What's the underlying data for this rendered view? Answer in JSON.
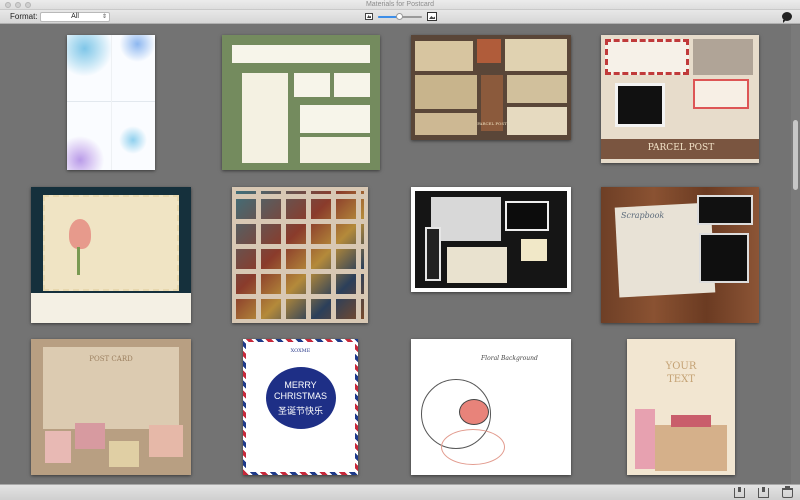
{
  "window": {
    "title": "Materials for Postcard"
  },
  "toolbar": {
    "format_label": "Format:",
    "format_value": "All",
    "zoom_level": 0.5
  },
  "icons": {
    "close": "close-window-icon",
    "minimize": "minimize-window-icon",
    "zoom": "zoom-window-icon",
    "zoom_small": "small-thumbnail-icon",
    "zoom_large": "large-thumbnail-icon",
    "chat": "speech-bubble-icon",
    "import": "import-icon",
    "export": "export-icon",
    "trash": "trash-icon"
  },
  "colors": {
    "background": "#737373",
    "accent": "#3d8ee8"
  },
  "thumbnails": [
    {
      "id": "floral-watercolor-cards"
    },
    {
      "id": "green-business-stationery"
    },
    {
      "id": "vintage-postcard-collage",
      "texts": [
        "PARCEL POST"
      ]
    },
    {
      "id": "airmail-envelope-collage",
      "texts": [
        "PARCEL POST"
      ]
    },
    {
      "id": "tulip-vintage-postcard"
    },
    {
      "id": "stamp-collection-sheet"
    },
    {
      "id": "photo-frames-collage"
    },
    {
      "id": "scrapbook-wood-collage",
      "texts": [
        "Scrapbook"
      ]
    },
    {
      "id": "post-card-stamps-kraft",
      "texts": [
        "POST CARD"
      ]
    },
    {
      "id": "merry-christmas-card",
      "texts": [
        "XOXME",
        "MERRY",
        "CHRISTMAS",
        "圣诞节快乐"
      ]
    },
    {
      "id": "floral-background-bird",
      "texts": [
        "Floral Background"
      ]
    },
    {
      "id": "your-text-castle",
      "texts": [
        "YOUR",
        "TEXT"
      ]
    }
  ]
}
